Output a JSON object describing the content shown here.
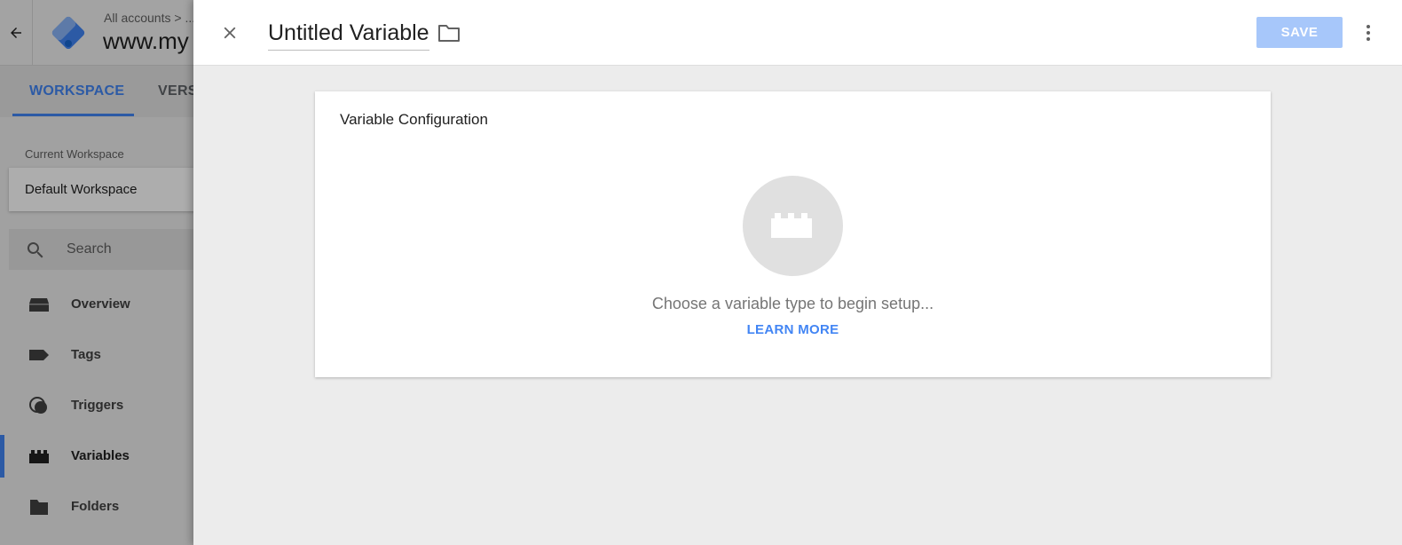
{
  "header": {
    "breadcrumb": "All accounts  >  ...",
    "container_name": "www.my"
  },
  "tabs": [
    {
      "label": "WORKSPACE",
      "active": true
    },
    {
      "label": "VERS",
      "active": false
    }
  ],
  "sidebar": {
    "workspace_label": "Current Workspace",
    "workspace_name": "Default Workspace",
    "search_placeholder": "Search",
    "items": [
      {
        "label": "Overview",
        "icon": "overview-icon"
      },
      {
        "label": "Tags",
        "icon": "tag-icon"
      },
      {
        "label": "Triggers",
        "icon": "trigger-icon"
      },
      {
        "label": "Variables",
        "icon": "variable-block-icon",
        "active": true
      },
      {
        "label": "Folders",
        "icon": "folder-icon"
      }
    ]
  },
  "sheet": {
    "title": "Untitled Variable",
    "save_label": "SAVE",
    "card": {
      "title": "Variable Configuration",
      "prompt": "Choose a variable type to begin setup...",
      "link": "LEARN MORE"
    }
  },
  "colors": {
    "accent": "#4285f4",
    "save_disabled": "#a7c7fa",
    "scrim": "rgba(0,0,0,0.32)"
  }
}
